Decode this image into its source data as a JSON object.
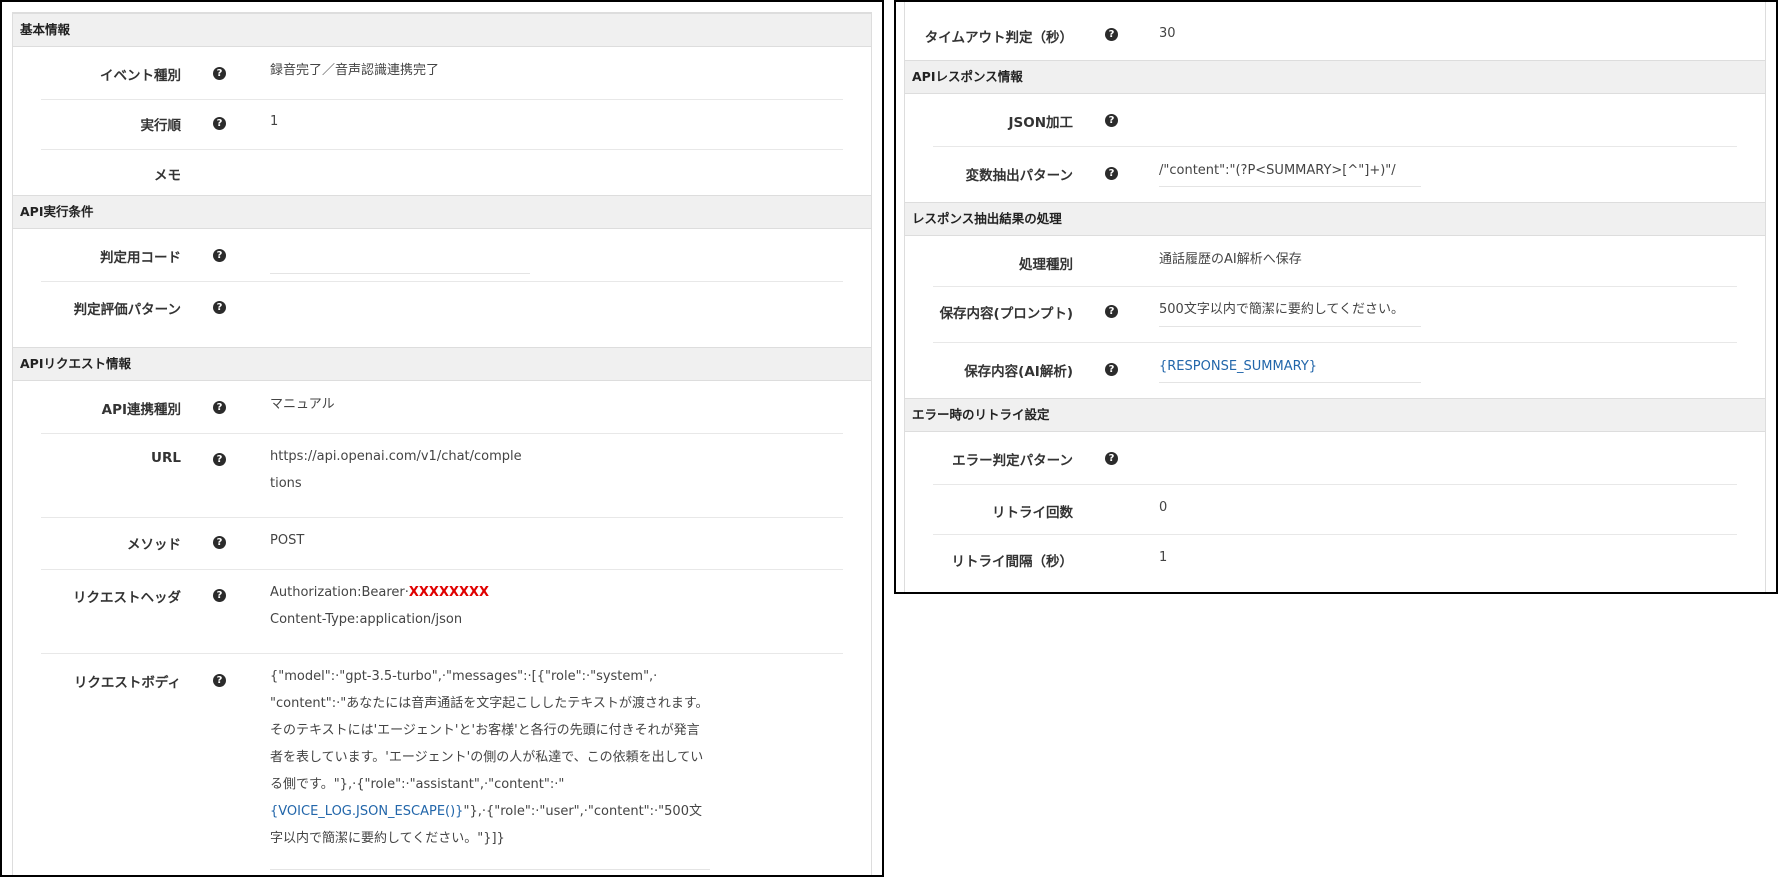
{
  "left": {
    "basic_header": "基本情報",
    "event_type_label": "イベント種別",
    "event_type_value": "録音完了／音声認識連携完了",
    "exec_order_label": "実行順",
    "exec_order_value": "1",
    "memo_label": "メモ",
    "api_cond_header": "API実行条件",
    "judge_code_label": "判定用コード",
    "judge_pattern_label": "判定評価パターン",
    "api_request_header": "APIリクエスト情報",
    "api_type_label": "API連携種別",
    "api_type_value": "マニュアル",
    "url_label": "URL",
    "url_line1": "https://api.openai.com/v1/chat/comple",
    "url_line2": "tions",
    "method_label": "メソッド",
    "method_value": "POST",
    "req_header_label": "リクエストヘッダ",
    "req_header_line1_prefix": "Authorization:Bearer·",
    "req_header_line1_secret": "XXXXXXXX",
    "req_header_line2": "Content-Type:application/json",
    "req_body_label": "リクエストボディ",
    "req_body_line1": "{\"model\":·\"gpt-3.5-turbo\",·\"messages\":·[{\"role\":·\"system\",·",
    "req_body_line2": "\"content\":·\"あなたには音声通話を文字起こししたテキストが渡されます。",
    "req_body_line3": "そのテキストには'エージェント'と'お客様'と各行の先頭に付きそれが発言",
    "req_body_line4": "者を表しています。'エージェント'の側の人が私達で、この依頼を出してい",
    "req_body_line5": "る側です。\"},·{\"role\":·\"assistant\",·\"content\":·\"",
    "req_body_line6_var": "{VOICE_LOG.JSON_ESCAPE()}",
    "req_body_line6_rest": "\"},·{\"role\":·\"user\",·\"content\":·\"500文",
    "req_body_line7": "字以内で簡潔に要約してください。\"}]}"
  },
  "right": {
    "timeout_label": "タイムアウト判定（秒）",
    "timeout_value": "30",
    "api_response_header": "APIレスポンス情報",
    "json_label": "JSON加工",
    "var_extract_label": "変数抽出パターン",
    "var_extract_value": "/\"content\":\"(?P<SUMMARY>[^\"]+)\"/",
    "resp_proc_header": "レスポンス抽出結果の処理",
    "proc_type_label": "処理種別",
    "proc_type_value": "通話履歴のAI解析へ保存",
    "save_prompt_label": "保存内容(プロンプト)",
    "save_prompt_value": "500文字以内で簡潔に要約してください。",
    "save_ai_label": "保存内容(AI解析)",
    "save_ai_value": "{RESPONSE_SUMMARY}",
    "retry_header": "エラー時のリトライ設定",
    "error_pattern_label": "エラー判定パターン",
    "retry_count_label": "リトライ回数",
    "retry_count_value": "0",
    "retry_interval_label": "リトライ間隔（秒）",
    "retry_interval_value": "1"
  },
  "icons": {
    "help": "question-circle-icon",
    "help_glyph": "?"
  },
  "colors": {
    "header_bg": "#f0f0f0",
    "secret": "#e00000",
    "variable": "#2266aa"
  }
}
